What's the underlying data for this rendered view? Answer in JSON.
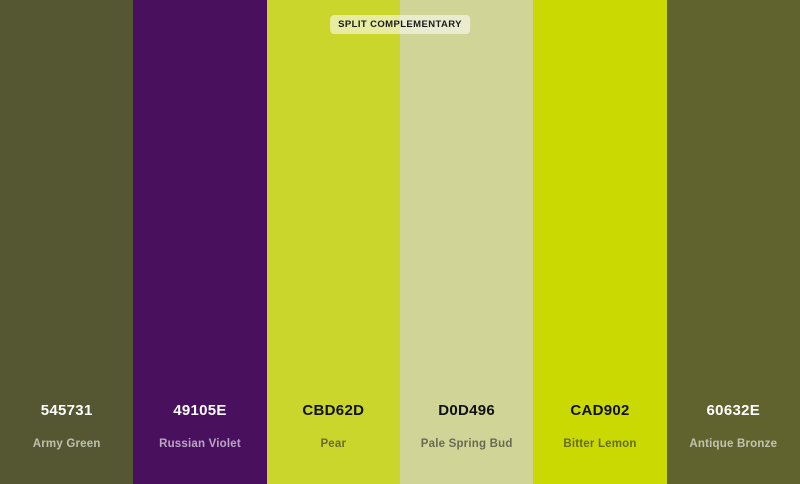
{
  "scheme_label": "SPLIT COMPLEMENTARY",
  "swatches": [
    {
      "hex": "545731",
      "name": "Army Green",
      "color": "#545731",
      "text_tone": "light"
    },
    {
      "hex": "49105E",
      "name": "Russian Violet",
      "color": "#49105E",
      "text_tone": "light"
    },
    {
      "hex": "CBD62D",
      "name": "Pear",
      "color": "#CBD62D",
      "text_tone": "dark"
    },
    {
      "hex": "D0D496",
      "name": "Pale Spring Bud",
      "color": "#D0D496",
      "text_tone": "dark"
    },
    {
      "hex": "CAD902",
      "name": "Bitter Lemon",
      "color": "#CAD902",
      "text_tone": "dark"
    },
    {
      "hex": "60632E",
      "name": "Antique Bronze",
      "color": "#60632E",
      "text_tone": "light"
    }
  ]
}
